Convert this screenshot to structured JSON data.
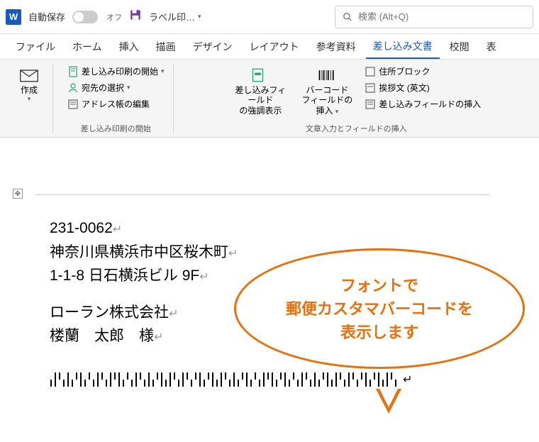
{
  "title_bar": {
    "autosave_label": "自動保存",
    "autosave_state": "オフ",
    "doc_title": "ラベル印…",
    "search_placeholder": "検索 (Alt+Q)"
  },
  "tabs": {
    "file": "ファイル",
    "home": "ホーム",
    "insert": "挿入",
    "draw": "描画",
    "design": "デザイン",
    "layout": "レイアウト",
    "references": "参考資料",
    "mailings": "差し込み文書",
    "review": "校閲",
    "view": "表"
  },
  "ribbon": {
    "create": {
      "label": "作成"
    },
    "start_group": {
      "start_merge": "差し込み印刷の開始",
      "select_recipients": "宛先の選択",
      "edit_recipients": "アドレス帳の編集",
      "group_label": "差し込み印刷の開始"
    },
    "highlight_fields": {
      "line1": "差し込みフィールド",
      "line2": "の強調表示"
    },
    "barcode": {
      "line1": "バーコード",
      "line2": "フィールドの挿入"
    },
    "insert_group": {
      "address_block": "住所ブロック",
      "greeting": "挨拶文 (英文)",
      "insert_merge_field": "差し込みフィールドの挿入",
      "group_label": "文章入力とフィールドの挿入"
    }
  },
  "document": {
    "postal": "231-0062",
    "address1": "神奈川県横浜市中区桜木町",
    "address2": "1-1-8 日石横浜ビル 9F",
    "company": "ローラン株式会社",
    "recipient": "楼蘭　太郎　様"
  },
  "callout": {
    "line1": "フォントで",
    "line2": "郵便カスタマバーコードを",
    "line3": "表示します"
  }
}
